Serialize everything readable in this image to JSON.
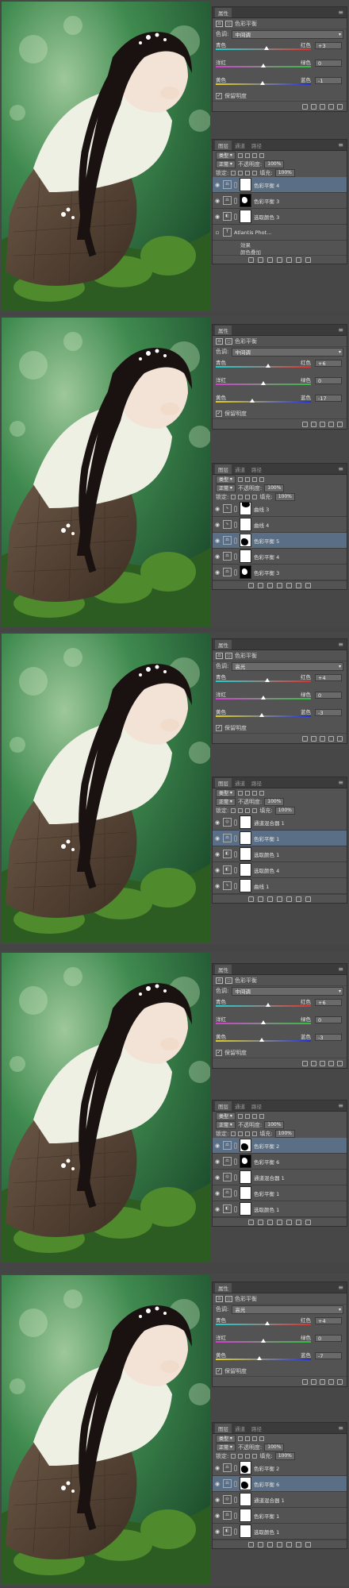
{
  "labels": {
    "properties": "属性",
    "layers": "图层",
    "channels": "通道",
    "paths": "路径",
    "type_kind": "类型",
    "normal": "正常",
    "opacity": "不透明度:",
    "fill": "填充:",
    "lock": "锁定:",
    "preserve": "保留明度",
    "color_balance": "色彩平衡",
    "effects": "效果",
    "color_overlay": "颜色叠加"
  },
  "steps": [
    {
      "tone": "中间调",
      "values": [
        "+3",
        "0",
        "-1"
      ],
      "thumbs": [
        0.53,
        0.5,
        0.49
      ],
      "opacity": "100%",
      "fill": "100%",
      "layers": [
        {
          "name": "色彩平衡 4",
          "type": "balance",
          "selected": true,
          "mask": "white"
        },
        {
          "name": "色彩平衡 3",
          "type": "balance",
          "selected": false,
          "mask": "dark"
        },
        {
          "name": "选取颜色 3",
          "type": "selective",
          "selected": false,
          "mask": "white"
        },
        {
          "name": "Atlantis Phot...",
          "type": "text",
          "selected": false,
          "mask": "none",
          "fx": true
        }
      ]
    },
    {
      "tone": "中间调",
      "values": [
        "+6",
        "0",
        "-17"
      ],
      "thumbs": [
        0.55,
        0.5,
        0.38
      ],
      "opacity": "100%",
      "fill": "100%",
      "layers": [
        {
          "name": "曲线 3",
          "type": "curves",
          "selected": false,
          "mask": "blobtop"
        },
        {
          "name": "曲线 4",
          "type": "curves",
          "selected": false,
          "mask": "white"
        },
        {
          "name": "色彩平衡 5",
          "type": "balance",
          "selected": true,
          "mask": "blob"
        },
        {
          "name": "色彩平衡 4",
          "type": "balance",
          "selected": false,
          "mask": "white"
        },
        {
          "name": "色彩平衡 3",
          "type": "balance",
          "selected": false,
          "mask": "dark"
        }
      ]
    },
    {
      "tone": "高光",
      "values": [
        "+4",
        "0",
        "-3"
      ],
      "thumbs": [
        0.54,
        0.5,
        0.48
      ],
      "opacity": "100%",
      "fill": "100%",
      "layers": [
        {
          "name": "通道混合器 1",
          "type": "mixer",
          "selected": false,
          "mask": "white"
        },
        {
          "name": "色彩平衡 1",
          "type": "balance",
          "selected": true,
          "mask": "white"
        },
        {
          "name": "选取颜色 1",
          "type": "selective",
          "selected": false,
          "mask": "white"
        },
        {
          "name": "选取颜色 4",
          "type": "selective",
          "selected": false,
          "mask": "white"
        },
        {
          "name": "曲线 1",
          "type": "curves",
          "selected": false,
          "mask": "white"
        }
      ]
    },
    {
      "tone": "中间调",
      "values": [
        "+6",
        "0",
        "-3"
      ],
      "thumbs": [
        0.55,
        0.5,
        0.48
      ],
      "opacity": "100%",
      "fill": "100%",
      "layers": [
        {
          "name": "色彩平衡 2",
          "type": "balance",
          "selected": true,
          "mask": "blob"
        },
        {
          "name": "色彩平衡 6",
          "type": "balance",
          "selected": false,
          "mask": "dark"
        },
        {
          "name": "通道混合器 1",
          "type": "mixer",
          "selected": false,
          "mask": "white"
        },
        {
          "name": "色彩平衡 1",
          "type": "balance",
          "selected": false,
          "mask": "white"
        },
        {
          "name": "选取颜色 1",
          "type": "selective",
          "selected": false,
          "mask": "white"
        }
      ]
    },
    {
      "tone": "高光",
      "values": [
        "+4",
        "0",
        "-7"
      ],
      "thumbs": [
        0.54,
        0.5,
        0.46
      ],
      "opacity": "100%",
      "fill": "100%",
      "layers": [
        {
          "name": "色彩平衡 2",
          "type": "balance",
          "selected": false,
          "mask": "blob"
        },
        {
          "name": "色彩平衡 6",
          "type": "balance",
          "selected": true,
          "mask": "blob"
        },
        {
          "name": "通道混合器 1",
          "type": "mixer",
          "selected": false,
          "mask": "white"
        },
        {
          "name": "色彩平衡 1",
          "type": "balance",
          "selected": false,
          "mask": "white"
        },
        {
          "name": "选取颜色 1",
          "type": "selective",
          "selected": false,
          "mask": "white"
        }
      ]
    }
  ],
  "slider_labels": [
    {
      "left": "青色",
      "right": "红色"
    },
    {
      "left": "洋红",
      "right": "绿色"
    },
    {
      "left": "黄色",
      "right": "蓝色"
    }
  ],
  "colors": {
    "selected_layer": "#5a6f86",
    "panel_bg": "#535353",
    "cyan_red": [
      "#1fd0d0",
      "#e0302a"
    ],
    "magenta_green": [
      "#d040d0",
      "#30c040"
    ],
    "yellow_blue": [
      "#e0d020",
      "#2030e0"
    ]
  }
}
